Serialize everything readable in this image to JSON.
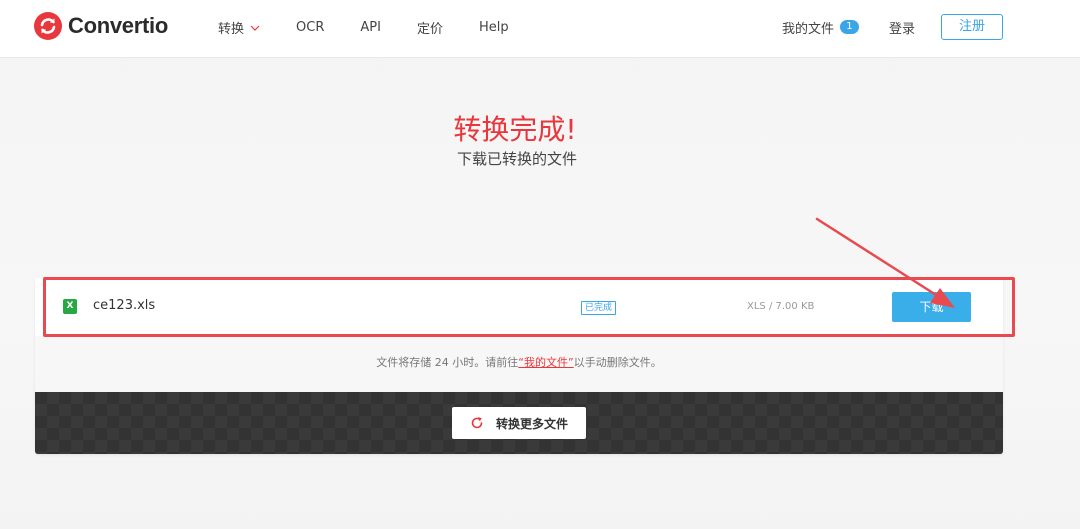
{
  "header": {
    "brand": "Convertio",
    "nav": [
      {
        "label": "转换"
      },
      {
        "label": "OCR"
      },
      {
        "label": "API"
      },
      {
        "label": "定价"
      },
      {
        "label": "Help"
      }
    ],
    "my_files_label": "我的文件",
    "my_files_count": "1",
    "login_label": "登录",
    "register_label": "注册"
  },
  "hero": {
    "title": "转换完成!",
    "subtitle": "下载已转换的文件"
  },
  "file": {
    "icon_label": "X",
    "name": "ce123.xls",
    "status": "已完成",
    "meta": "XLS / 7.00 KB",
    "download_label": "下载"
  },
  "info": {
    "prefix": "文件将存储 24 小时。请前往",
    "link": "“我的文件”",
    "suffix": "以手动删除文件。"
  },
  "more": {
    "label": "转换更多文件"
  },
  "colors": {
    "brand_red": "#e8383d",
    "accent_blue": "#3aaee8",
    "annotation_red": "#e84a4f"
  }
}
